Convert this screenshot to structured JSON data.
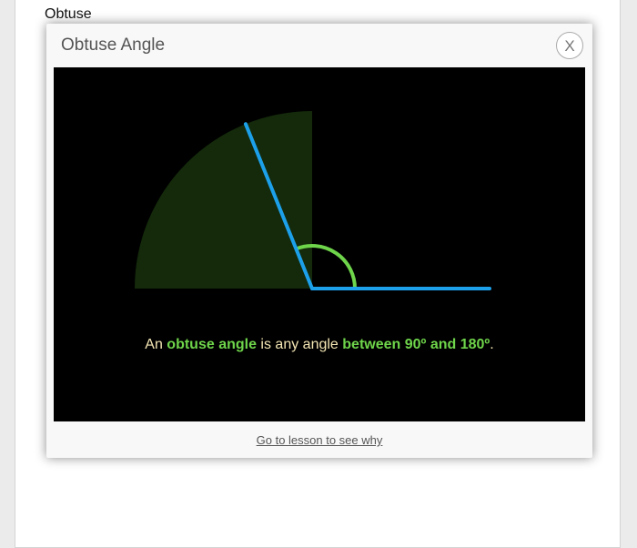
{
  "background_list": {
    "items": [
      "Obtuse",
      "",
      "",
      "",
      "",
      ""
    ]
  },
  "modal": {
    "title": "Obtuse Angle",
    "close_label": "X",
    "caption": {
      "part1": "An ",
      "term": "obtuse angle",
      "part2": " is any angle ",
      "range": "between 90º and 180º",
      "part3": "."
    },
    "footer_link": "Go to lesson to see why"
  },
  "illustration": {
    "angle_degrees": 112,
    "colors": {
      "ray": "#1da0ea",
      "arc": "#6ed44a",
      "sector_fill": "#142a0b",
      "caption_text": "#f4e6b4",
      "highlight": "#6ed44a"
    }
  }
}
